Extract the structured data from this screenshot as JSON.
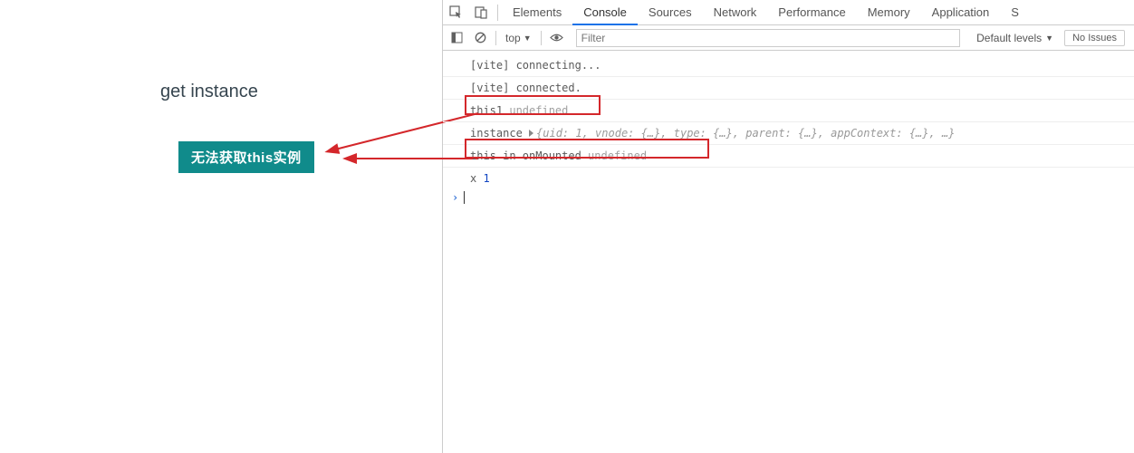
{
  "page": {
    "title": "get instance",
    "badge_text": "无法获取this实例"
  },
  "devtools": {
    "tabs": {
      "t0": "Elements",
      "t1": "Console",
      "t2": "Sources",
      "t3": "Network",
      "t4": "Performance",
      "t5": "Memory",
      "t6": "Application",
      "t7": "S"
    },
    "toolbar": {
      "context": "top",
      "filter_placeholder": "Filter",
      "levels": "Default levels",
      "no_issues": "No Issues"
    },
    "logs": {
      "l0": "[vite] connecting...",
      "l1": "[vite] connected.",
      "l2_a": "this1 ",
      "l2_b": "undefined",
      "l3_a": "instance ",
      "l3_b": "{uid: 1, vnode: {…}, type: {…}, parent: {…}, appContext: {…}, …}",
      "l4_a": "this in onMounted ",
      "l4_b": "undefined",
      "l5_a": "x ",
      "l5_b": "1"
    }
  }
}
